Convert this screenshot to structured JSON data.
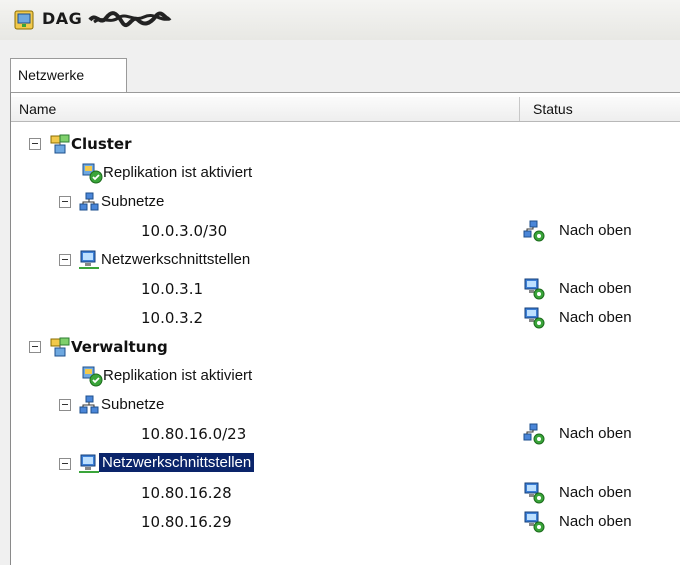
{
  "window": {
    "title": "DAG",
    "title_icon": "dag-server-icon",
    "title_suffix_icon": "redacted-scribble"
  },
  "tabs": [
    {
      "label": "Netzwerke",
      "active": true
    }
  ],
  "columns": {
    "name": "Name",
    "status": "Status"
  },
  "tree": {
    "cluster": {
      "label": "Cluster",
      "icon": "network-group-icon"
    },
    "cluster_replication": {
      "label": "Replikation ist aktiviert",
      "icon": "replication-icon"
    },
    "cluster_subnets": {
      "label": "Subnetze",
      "icon": "subnet-icon"
    },
    "cluster_subnet_1": {
      "label": "10.0.3.0/30",
      "status": "Nach oben",
      "status_icon": "subnet-up-icon"
    },
    "cluster_interfaces": {
      "label": "Netzwerkschnittstellen",
      "icon": "nic-icon"
    },
    "cluster_if_1": {
      "label": "10.0.3.1",
      "status": "Nach oben",
      "status_icon": "nic-up-icon"
    },
    "cluster_if_2": {
      "label": "10.0.3.2",
      "status": "Nach oben",
      "status_icon": "nic-up-icon"
    },
    "mgmt": {
      "label": "Verwaltung",
      "icon": "network-group-icon"
    },
    "mgmt_replication": {
      "label": "Replikation ist aktiviert",
      "icon": "replication-icon"
    },
    "mgmt_subnets": {
      "label": "Subnetze",
      "icon": "subnet-icon"
    },
    "mgmt_subnet_1": {
      "label": "10.80.16.0/23",
      "status": "Nach oben",
      "status_icon": "subnet-up-icon"
    },
    "mgmt_interfaces": {
      "label": "Netzwerkschnittstellen",
      "icon": "nic-icon",
      "selected": true
    },
    "mgmt_if_1": {
      "label": "10.80.16.28",
      "status": "Nach oben",
      "status_icon": "nic-up-icon"
    },
    "mgmt_if_2": {
      "label": "10.80.16.29",
      "status": "Nach oben",
      "status_icon": "nic-up-icon"
    }
  },
  "colors": {
    "selection": "#0a246a",
    "status_ok": "#2e9b2e"
  }
}
